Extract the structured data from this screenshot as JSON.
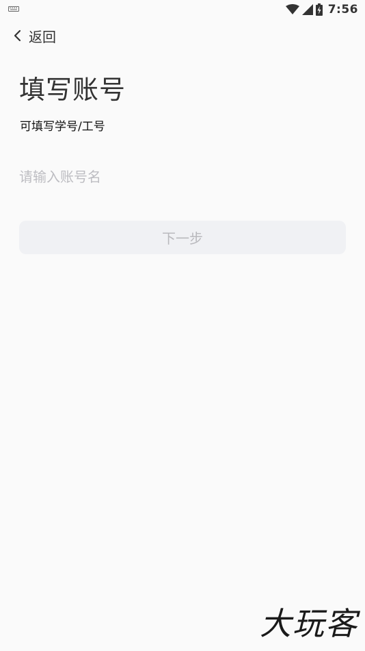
{
  "status_bar": {
    "time": "7:56",
    "icons": [
      "keyboard-icon",
      "wifi-icon",
      "cellular-signal-icon",
      "battery-charging-icon"
    ]
  },
  "header": {
    "back_label": "返回",
    "back_icon": "chevron-left-icon"
  },
  "main": {
    "title": "填写账号",
    "subtitle": "可填写学号/工号",
    "input": {
      "value": "",
      "placeholder": "请输入账号名"
    },
    "next_button_label": "下一步"
  },
  "watermark": "大玩客",
  "colors": {
    "background": "#fafafa",
    "button_disabled_bg": "#f0f1f4",
    "button_disabled_text": "#b9b9bd",
    "placeholder": "#bdbdc2"
  }
}
